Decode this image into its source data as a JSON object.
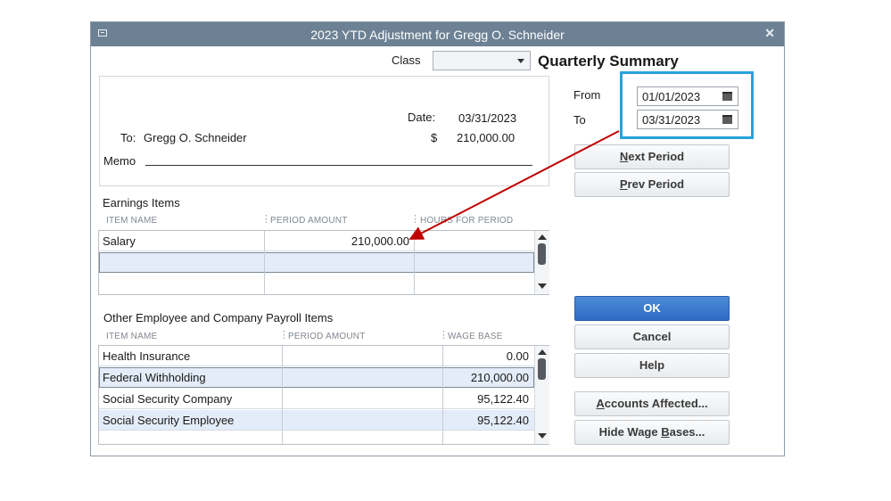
{
  "window": {
    "title": "2023 YTD Adjustment for Gregg O. Schneider"
  },
  "class_label": "Class",
  "class_value": "",
  "quarterly_summary": "Quarterly Summary",
  "date_label": "Date:",
  "date_value": "03/31/2023",
  "to_label": "To:",
  "to_value": "Gregg O. Schneider",
  "currency_symbol": "$",
  "amount_value": "210,000.00",
  "memo_label": "Memo",
  "from_label": "From",
  "from_date": "01/01/2023",
  "to_date_label": "To",
  "to_date": "03/31/2023",
  "buttons": {
    "next_period_u": "N",
    "next_period_rest": "ext Period",
    "prev_period_u": "P",
    "prev_period_rest": "rev Period",
    "ok": "OK",
    "cancel": "Cancel",
    "help": "Help",
    "accounts_u": "A",
    "accounts_rest": "ccounts Affected...",
    "hide_pre": "Hide Wage ",
    "hide_u": "B",
    "hide_rest": "ases..."
  },
  "earnings": {
    "title": "Earnings Items",
    "columns": [
      "ITEM NAME",
      "PERIOD AMOUNT",
      "HOURS FOR PERIOD"
    ],
    "rows": [
      {
        "item": "Salary",
        "amount": "210,000.00",
        "hours": ""
      },
      {
        "item": "",
        "amount": "",
        "hours": ""
      },
      {
        "item": "",
        "amount": "",
        "hours": ""
      }
    ]
  },
  "other_items": {
    "title": "Other Employee and Company Payroll Items",
    "columns": [
      "ITEM NAME",
      "PERIOD AMOUNT",
      "WAGE BASE"
    ],
    "rows": [
      {
        "item": "Health Insurance",
        "amount": "",
        "wage_base": "0.00"
      },
      {
        "item": "Federal Withholding",
        "amount": "",
        "wage_base": "210,000.00"
      },
      {
        "item": "Social Security Company",
        "amount": "",
        "wage_base": "95,122.40"
      },
      {
        "item": "Social Security Employee",
        "amount": "",
        "wage_base": "95,122.40"
      },
      {
        "item": "",
        "amount": "",
        "wage_base": ""
      }
    ]
  },
  "colors": {
    "highlight": "#27a2dc",
    "arrow": "#c00000",
    "ok_button": "#2f6bc2"
  }
}
